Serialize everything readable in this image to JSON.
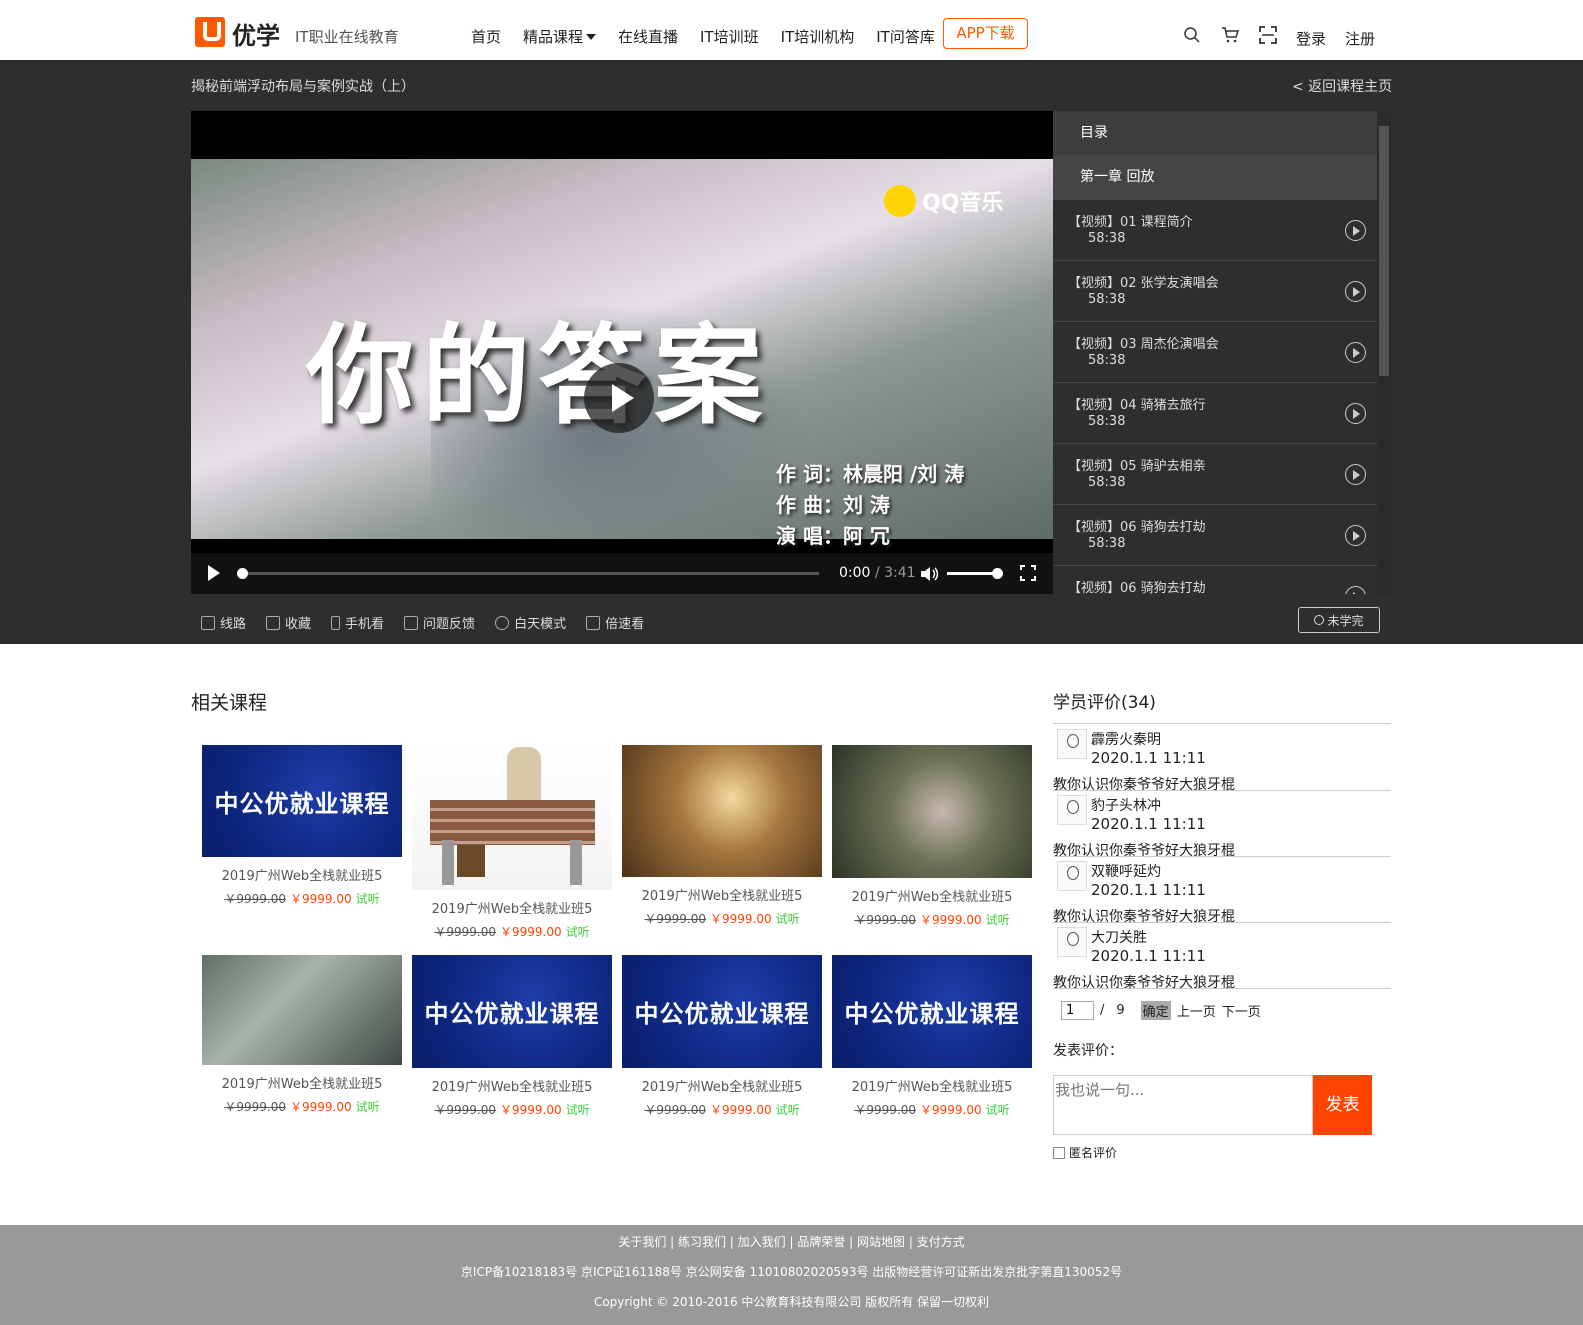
{
  "header": {
    "logo": "优学",
    "tagline": "IT职业在线教育",
    "nav": [
      "首页",
      "精品课程",
      "在线直播",
      "IT培训班",
      "IT培训机构",
      "IT问答库"
    ],
    "app_button": "APP下载",
    "icons": [
      "search-icon",
      "cart-icon",
      "scan-icon"
    ],
    "login": "登录",
    "register": "注册"
  },
  "course": {
    "title": "揭秘前端浮动布局与案例实战（上）",
    "back": "< 返回课程主页"
  },
  "player": {
    "brand": "QQ音乐",
    "video_title": "你的答案",
    "credits": [
      "作  词：林晨阳 /刘  涛",
      "作  曲：刘  涛",
      "演  唱：阿  冗"
    ],
    "time_current": "0:00",
    "time_separator": "/",
    "time_total": "3:41",
    "progress": 0,
    "volume": 0.9
  },
  "catalog": {
    "header": "目录",
    "chapter": "第一章 回放",
    "lessons": [
      {
        "name": "【视频】01 课程简介",
        "time": "58:38"
      },
      {
        "name": "【视频】02 张学友演唱会",
        "time": "58:38"
      },
      {
        "name": "【视频】03 周杰伦演唱会",
        "time": "58:38"
      },
      {
        "name": "【视频】04 骑猪去旅行",
        "time": "58:38"
      },
      {
        "name": "【视频】05 骑驴去相亲",
        "time": "58:38"
      },
      {
        "name": "【视频】06 骑狗去打劫",
        "time": "58:38"
      },
      {
        "name": "【视频】06 骑狗去打劫",
        "time": ""
      }
    ]
  },
  "toolbar": {
    "items": [
      "线路",
      "收藏",
      "手机看",
      "问题反馈",
      "白天模式",
      "倍速看"
    ],
    "status": "未学完"
  },
  "related": {
    "title": "相关课程",
    "banner_text": "中公优就业课程",
    "courses": [
      {
        "name": "2019广州Web全栈就业班5",
        "old": "￥9999.00",
        "price": "￥9999.00",
        "trial": "试听"
      },
      {
        "name": "2019广州Web全栈就业班5",
        "old": "￥9999.00",
        "price": "￥9999.00",
        "trial": "试听"
      },
      {
        "name": "2019广州Web全栈就业班5",
        "old": "￥9999.00",
        "price": "￥9999.00",
        "trial": "试听"
      },
      {
        "name": "2019广州Web全栈就业班5",
        "old": "￥9999.00",
        "price": "￥9999.00",
        "trial": "试听"
      },
      {
        "name": "2019广州Web全栈就业班5",
        "old": "￥9999.00",
        "price": "￥9999.00",
        "trial": "试听"
      },
      {
        "name": "2019广州Web全栈就业班5",
        "old": "￥9999.00",
        "price": "￥9999.00",
        "trial": "试听"
      },
      {
        "name": "2019广州Web全栈就业班5",
        "old": "￥9999.00",
        "price": "￥9999.00",
        "trial": "试听"
      },
      {
        "name": "2019广州Web全栈就业班5",
        "old": "￥9999.00",
        "price": "￥9999.00",
        "trial": "试听"
      }
    ]
  },
  "reviews": {
    "title": "学员评价(34)",
    "items": [
      {
        "name": "霹雳火秦明",
        "date": "2020.1.1 11:11",
        "text": "教你认识你秦爷爷好大狼牙棍"
      },
      {
        "name": "豹子头林冲",
        "date": "2020.1.1 11:11",
        "text": "教你认识你秦爷爷好大狼牙棍"
      },
      {
        "name": "双鞭呼延灼",
        "date": "2020.1.1 11:11",
        "text": "教你认识你秦爷爷好大狼牙棍"
      },
      {
        "name": "大刀关胜",
        "date": "2020.1.1 11:11",
        "text": "教你认识你秦爷爷好大狼牙棍"
      }
    ],
    "pager": {
      "page": "1",
      "sep": "/",
      "total": "9",
      "confirm": "确定",
      "prev": "上一页",
      "next": "下一页"
    },
    "post_label": "发表评价：",
    "post_placeholder": "我也说一句...",
    "post_button": "发表",
    "anonymous": "匿名评价"
  },
  "footer": {
    "links": "关于我们 | 练习我们 | 加入我们 | 品牌荣誉 | 网站地图 | 支付方式",
    "icp": "京ICP备10218183号  京ICP证161188号  京公网安备  11010802020593号  出版物经营许可证新出发京批字第直130052号",
    "copyright": "Copyright © 2010-2016 中公教育科技有限公司 版权所有 保留一切权利"
  },
  "colors": {
    "accent": "#ff5a00",
    "dark_bg": "#2e2e2e",
    "footer_bg": "#999999",
    "trial": "#3ad13a"
  }
}
